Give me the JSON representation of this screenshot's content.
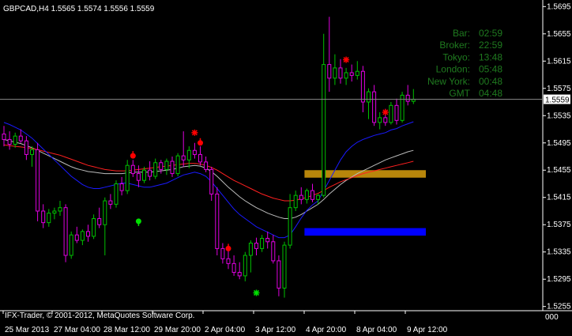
{
  "window": {
    "symbol_line": "GBPCAD,H4  1.5565 1.5574 1.5556 1.5559",
    "footer_text": "IFX-Trader, © 2001-2012, MetaQuotes Software Corp.",
    "scroll_label": "000"
  },
  "info_panel": {
    "rows": [
      {
        "label": "Bar:",
        "value": "02:59"
      },
      {
        "label": "Broker:",
        "value": "22:59"
      },
      {
        "label": "Tokyo:",
        "value": "13:48"
      },
      {
        "label": "London:",
        "value": "05:48"
      },
      {
        "label": "New York:",
        "value": "00:48"
      },
      {
        "label": "GMT",
        "value": "04:48"
      }
    ]
  },
  "colors": {
    "background": "#000000",
    "bull_candle": "#00c000",
    "bear_candle": "#e000e0",
    "blue_ma": "#1a1aff",
    "red_ma": "#ff2020",
    "white_ma": "#bbbbbb",
    "info_label": "#1f7a1f",
    "info_value": "#1f7a1f",
    "price_line": "#8a8a8a",
    "axis_text": "#ffffff",
    "gold_zone": "#b8860b",
    "blue_zone": "#0000ff",
    "signal_red": "#ff0000",
    "signal_green": "#00e000"
  },
  "chart_data": {
    "type": "candlestick",
    "symbol": "GBPCAD",
    "timeframe": "H4",
    "ylim": [
      1.525,
      1.57
    ],
    "y_ticks": [
      "1.5695",
      "1.5655",
      "1.5615",
      "1.5575",
      "1.5535",
      "1.5495",
      "1.5455",
      "1.5415",
      "1.5375",
      "1.5335",
      "1.5295",
      "1.5255"
    ],
    "x_ticks": [
      "25 Mar 2013",
      "27 Mar 04:00",
      "28 Mar 12:00",
      "29 Mar 20:00",
      "2 Apr 04:00",
      "3 Apr 12:00",
      "4 Apr 20:00",
      "8 Apr 04:00",
      "9 Apr 12:00"
    ],
    "current_price": "1.5559",
    "candles": [
      [
        1.5508,
        1.552,
        1.549,
        1.55
      ],
      [
        1.55,
        1.5512,
        1.5485,
        1.5493
      ],
      [
        1.5493,
        1.551,
        1.5488,
        1.5505
      ],
      [
        1.5505,
        1.5515,
        1.5495,
        1.5498
      ],
      [
        1.5498,
        1.5505,
        1.547,
        1.5478
      ],
      [
        1.5478,
        1.549,
        1.546,
        1.5485
      ],
      [
        1.5485,
        1.5495,
        1.538,
        1.5395
      ],
      [
        1.5395,
        1.5405,
        1.537,
        1.5378
      ],
      [
        1.5378,
        1.5398,
        1.5372,
        1.5392
      ],
      [
        1.5392,
        1.54,
        1.5383,
        1.5395
      ],
      [
        1.5395,
        1.541,
        1.5388,
        1.54
      ],
      [
        1.54,
        1.5405,
        1.532,
        1.533
      ],
      [
        1.533,
        1.5365,
        1.5325,
        1.536
      ],
      [
        1.536,
        1.5372,
        1.5348,
        1.5352
      ],
      [
        1.5352,
        1.5368,
        1.5345,
        1.5365
      ],
      [
        1.5365,
        1.5375,
        1.535,
        1.5358
      ],
      [
        1.5358,
        1.539,
        1.5354,
        1.5384
      ],
      [
        1.5384,
        1.54,
        1.537,
        1.5375
      ],
      [
        1.5375,
        1.5415,
        1.533,
        1.541
      ],
      [
        1.541,
        1.542,
        1.5398,
        1.5405
      ],
      [
        1.5405,
        1.544,
        1.54,
        1.5435
      ],
      [
        1.5435,
        1.5445,
        1.5418,
        1.5425
      ],
      [
        1.5425,
        1.547,
        1.542,
        1.5462
      ],
      [
        1.5462,
        1.547,
        1.5445,
        1.545
      ],
      [
        1.545,
        1.5462,
        1.543,
        1.544
      ],
      [
        1.544,
        1.546,
        1.5436,
        1.5455
      ],
      [
        1.5455,
        1.5468,
        1.544,
        1.5446
      ],
      [
        1.5446,
        1.5472,
        1.5442,
        1.5466
      ],
      [
        1.5466,
        1.547,
        1.545,
        1.5456
      ],
      [
        1.5456,
        1.5472,
        1.5448,
        1.5468
      ],
      [
        1.5468,
        1.5475,
        1.5445,
        1.545
      ],
      [
        1.545,
        1.548,
        1.5446,
        1.5476
      ],
      [
        1.5476,
        1.5512,
        1.546,
        1.547
      ],
      [
        1.547,
        1.549,
        1.5458,
        1.5484
      ],
      [
        1.5484,
        1.5495,
        1.5472,
        1.5478
      ],
      [
        1.5478,
        1.549,
        1.5462,
        1.5467
      ],
      [
        1.5467,
        1.5475,
        1.5452,
        1.5456
      ],
      [
        1.5456,
        1.546,
        1.541,
        1.542
      ],
      [
        1.542,
        1.543,
        1.533,
        1.534
      ],
      [
        1.534,
        1.5348,
        1.5318,
        1.5325
      ],
      [
        1.5325,
        1.5338,
        1.531,
        1.5318
      ],
      [
        1.5318,
        1.533,
        1.53,
        1.5305
      ],
      [
        1.5305,
        1.532,
        1.5295,
        1.53
      ],
      [
        1.53,
        1.5335,
        1.5292,
        1.533
      ],
      [
        1.533,
        1.5352,
        1.5305,
        1.5348
      ],
      [
        1.5348,
        1.5356,
        1.533,
        1.534
      ],
      [
        1.534,
        1.536,
        1.5335,
        1.5355
      ],
      [
        1.5355,
        1.5365,
        1.534,
        1.535
      ],
      [
        1.535,
        1.536,
        1.5318,
        1.5322
      ],
      [
        1.5322,
        1.533,
        1.527,
        1.5282
      ],
      [
        1.5282,
        1.535,
        1.5268,
        1.5345
      ],
      [
        1.5345,
        1.542,
        1.534,
        1.54
      ],
      [
        1.54,
        1.5425,
        1.5395,
        1.5418
      ],
      [
        1.5418,
        1.543,
        1.5405,
        1.5412
      ],
      [
        1.5412,
        1.5428,
        1.5406,
        1.5425
      ],
      [
        1.5425,
        1.5435,
        1.5408,
        1.5412
      ],
      [
        1.5412,
        1.542,
        1.5405,
        1.5418
      ],
      [
        1.5418,
        1.5655,
        1.5415,
        1.561
      ],
      [
        1.561,
        1.568,
        1.557,
        1.559
      ],
      [
        1.559,
        1.5625,
        1.558,
        1.5605
      ],
      [
        1.5605,
        1.5618,
        1.5582,
        1.559
      ],
      [
        1.559,
        1.5605,
        1.558,
        1.5598
      ],
      [
        1.5598,
        1.561,
        1.5585,
        1.5594
      ],
      [
        1.5594,
        1.5615,
        1.5588,
        1.56
      ],
      [
        1.56,
        1.5608,
        1.554,
        1.5555
      ],
      [
        1.5555,
        1.5575,
        1.553,
        1.557
      ],
      [
        1.557,
        1.558,
        1.552,
        1.5525
      ],
      [
        1.5525,
        1.554,
        1.5515,
        1.5532
      ],
      [
        1.5532,
        1.5545,
        1.552,
        1.5525
      ],
      [
        1.5525,
        1.5555,
        1.5522,
        1.555
      ],
      [
        1.555,
        1.556,
        1.5522,
        1.5528
      ],
      [
        1.5528,
        1.557,
        1.5525,
        1.5565
      ],
      [
        1.5565,
        1.558,
        1.555,
        1.5556
      ],
      [
        1.5556,
        1.5574,
        1.5552,
        1.5559
      ]
    ],
    "ma_blue": [
      1.5525,
      1.5522,
      1.5518,
      1.5514,
      1.5508,
      1.5502,
      1.5494,
      1.5486,
      1.5478,
      1.547,
      1.5462,
      1.5454,
      1.5446,
      1.544,
      1.5434,
      1.543,
      1.5428,
      1.5428,
      1.543,
      1.5432,
      1.5434,
      1.5436,
      1.5436,
      1.5434,
      1.5432,
      1.543,
      1.543,
      1.5432,
      1.5434,
      1.5436,
      1.544,
      1.5444,
      1.5448,
      1.545,
      1.5452,
      1.545,
      1.5446,
      1.5438,
      1.5428,
      1.5418,
      1.5408,
      1.5398,
      1.539,
      1.5384,
      1.5378,
      1.5372,
      1.5368,
      1.5364,
      1.536,
      1.5356,
      1.5356,
      1.536,
      1.5372,
      1.5385,
      1.5396,
      1.5404,
      1.541,
      1.5425,
      1.544,
      1.5455,
      1.547,
      1.5482,
      1.549,
      1.5496,
      1.55,
      1.5503,
      1.5506,
      1.5508,
      1.551,
      1.5514,
      1.5516,
      1.552,
      1.5523,
      1.5526
    ],
    "ma_red": [
      1.5492,
      1.5491,
      1.549,
      1.5489,
      1.5488,
      1.5487,
      1.5485,
      1.5483,
      1.5481,
      1.5479,
      1.5477,
      1.5474,
      1.5471,
      1.5468,
      1.5465,
      1.5462,
      1.546,
      1.5458,
      1.5456,
      1.5455,
      1.5454,
      1.5454,
      1.5454,
      1.5455,
      1.5456,
      1.5457,
      1.5458,
      1.5459,
      1.546,
      1.5461,
      1.5462,
      1.5463,
      1.5464,
      1.5465,
      1.5465,
      1.5464,
      1.5462,
      1.5459,
      1.5455,
      1.545,
      1.5445,
      1.544,
      1.5436,
      1.5432,
      1.5428,
      1.5424,
      1.542,
      1.5417,
      1.5414,
      1.5412,
      1.541,
      1.541,
      1.5411,
      1.5413,
      1.5415,
      1.5418,
      1.5421,
      1.5425,
      1.543,
      1.5434,
      1.5438,
      1.5441,
      1.5444,
      1.5447,
      1.545,
      1.5452,
      1.5454,
      1.5456,
      1.5458,
      1.546,
      1.5462,
      1.5464,
      1.5466,
      1.5468
    ],
    "ma_white": [
      1.55,
      1.5498,
      1.5496,
      1.5494,
      1.5491,
      1.5488,
      1.5484,
      1.548,
      1.5476,
      1.5472,
      1.5468,
      1.5464,
      1.546,
      1.5457,
      1.5455,
      1.5453,
      1.5452,
      1.5451,
      1.545,
      1.545,
      1.545,
      1.545,
      1.5451,
      1.5452,
      1.5452,
      1.5452,
      1.5452,
      1.5453,
      1.5454,
      1.5455,
      1.5456,
      1.5458,
      1.546,
      1.5461,
      1.5462,
      1.5461,
      1.5458,
      1.5453,
      1.5446,
      1.5438,
      1.543,
      1.5423,
      1.5416,
      1.541,
      1.5405,
      1.54,
      1.5396,
      1.5392,
      1.5389,
      1.5386,
      1.5384,
      1.5384,
      1.5386,
      1.539,
      1.5395,
      1.54,
      1.5405,
      1.5412,
      1.542,
      1.5427,
      1.5434,
      1.544,
      1.5445,
      1.545,
      1.5454,
      1.5458,
      1.5462,
      1.5466,
      1.547,
      1.5473,
      1.5476,
      1.5479,
      1.5482,
      1.5484
    ],
    "zones": [
      {
        "name": "gold-zone",
        "y_top": 1.5455,
        "y_bottom": 1.5444,
        "from_index": 54
      },
      {
        "name": "blue-zone",
        "y_top": 1.537,
        "y_bottom": 1.5359,
        "from_index": 54
      }
    ],
    "signals": [
      {
        "type": "red-dot",
        "index": 23,
        "price": 1.5476
      },
      {
        "type": "green-dot",
        "index": 24,
        "price": 1.538
      },
      {
        "type": "red-star",
        "index": 34,
        "price": 1.551
      },
      {
        "type": "red-dot",
        "index": 35,
        "price": 1.5495
      },
      {
        "type": "red-dot",
        "index": 40,
        "price": 1.534
      },
      {
        "type": "green-star",
        "index": 45,
        "price": 1.5275
      },
      {
        "type": "red-star",
        "index": 61,
        "price": 1.5617
      },
      {
        "type": "red-star",
        "index": 68,
        "price": 1.554
      }
    ]
  }
}
